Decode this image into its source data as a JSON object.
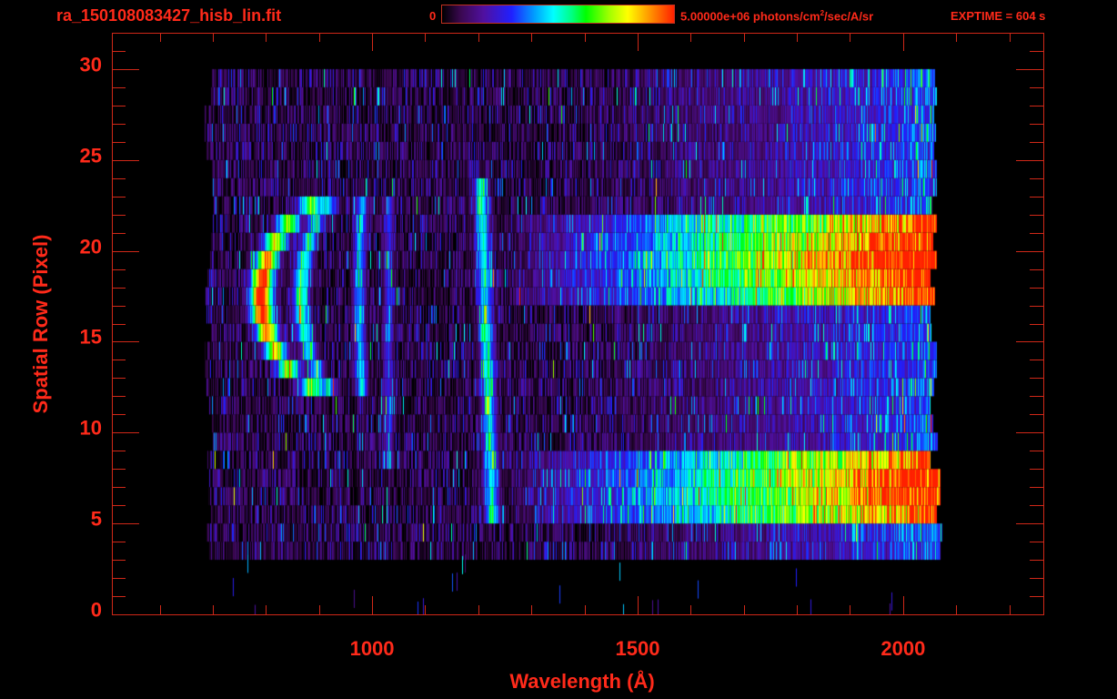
{
  "header": {
    "title": "ra_150108083427_hisb_lin.fit",
    "colorbar_min_label": "0",
    "colorbar_max_label": "5.00000e+06 photons/cm",
    "colorbar_max_sup": "2",
    "colorbar_max_suffix": "/sec/A/sr",
    "exptime": "EXPTIME = 604 s"
  },
  "chart_data": {
    "type": "heatmap",
    "title": "ra_150108083427_hisb_lin.fit",
    "xlabel": "Wavelength (Å)",
    "ylabel": "Spatial Row (Pixel)",
    "xlim": [
      510,
      2264
    ],
    "ylim": [
      0,
      32
    ],
    "x_ticks": [
      1000,
      1500,
      2000
    ],
    "x_tick_labels": [
      "1000",
      "1500",
      "2000"
    ],
    "x_minor_step": 100,
    "y_ticks": [
      0,
      5,
      10,
      15,
      20,
      25,
      30
    ],
    "y_tick_labels": [
      "0",
      "5",
      "10",
      "15",
      "20",
      "25",
      "30"
    ],
    "y_minor_step": 1,
    "colorbar": {
      "min": 0,
      "max": 5000000,
      "units": "photons/cm^2/sec/A/sr",
      "colormap": "rainbow"
    },
    "detector_rows": [
      3,
      30
    ],
    "detector_wavelength_range": [
      680,
      2065
    ],
    "emission_line_wavelength": 1216,
    "continuum_bands_rows": [
      [
        5,
        9
      ],
      [
        17,
        22
      ]
    ],
    "axis_color": "#d02818",
    "text_color": "#ff2a1a"
  }
}
